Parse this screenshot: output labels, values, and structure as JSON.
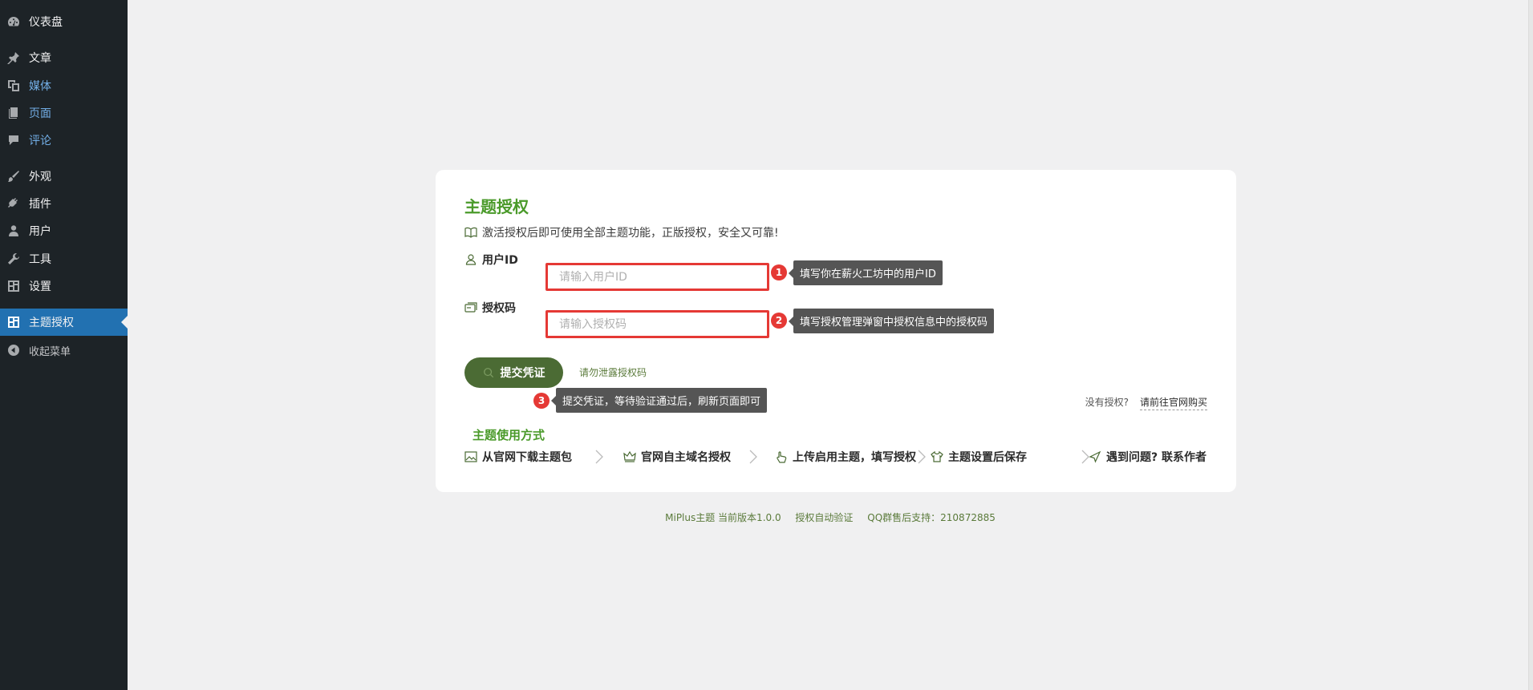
{
  "sidebar": {
    "items": [
      {
        "label": "仪表盘",
        "icon": "dashboard-icon"
      },
      {
        "label": "文章",
        "icon": "pin-icon"
      },
      {
        "label": "媒体",
        "icon": "media-icon"
      },
      {
        "label": "页面",
        "icon": "page-icon"
      },
      {
        "label": "评论",
        "icon": "comment-icon"
      },
      {
        "label": "外观",
        "icon": "brush-icon"
      },
      {
        "label": "插件",
        "icon": "plugin-icon"
      },
      {
        "label": "用户",
        "icon": "user-icon"
      },
      {
        "label": "工具",
        "icon": "wrench-icon"
      },
      {
        "label": "设置",
        "icon": "settings-icon"
      },
      {
        "label": "主题授权",
        "icon": "theme-auth-icon"
      },
      {
        "label": "收起菜单",
        "icon": "collapse-icon"
      }
    ]
  },
  "card": {
    "title": "主题授权",
    "subtitle": "激活授权后即可使用全部主题功能，正版授权，安全又可靠!",
    "user_id": {
      "label": "用户ID",
      "placeholder": "请输入用户ID",
      "value": ""
    },
    "auth_code": {
      "label": "授权码",
      "placeholder": "请输入授权码",
      "value": ""
    },
    "submit_label": "提交凭证",
    "warning": "请勿泄露授权码",
    "no_auth": "没有授权?",
    "buy_link": "请前往官网购买",
    "usage_title": "主题使用方式",
    "steps": [
      "从官网下载主题包",
      "官网自主域名授权",
      "上传启用主题，填写授权",
      "主题设置后保存",
      "遇到问题? 联系作者"
    ]
  },
  "annotations": [
    {
      "number": "1",
      "text": "填写你在薪火工坊中的用户ID"
    },
    {
      "number": "2",
      "text": "填写授权管理弹窗中授权信息中的授权码"
    },
    {
      "number": "3",
      "text": "提交凭证，等待验证通过后，刷新页面即可"
    }
  ],
  "footer": {
    "version": "MiPlus主题 当前版本1.0.0",
    "verify": "授权自动验证",
    "support": "QQ群售后支持：210872885"
  },
  "colors": {
    "sidebar_bg": "#1d2327",
    "active_bg": "#2271b1",
    "title_green": "#4a9a2a",
    "button_green": "#4b6b34",
    "annotation_red": "#e53935"
  }
}
